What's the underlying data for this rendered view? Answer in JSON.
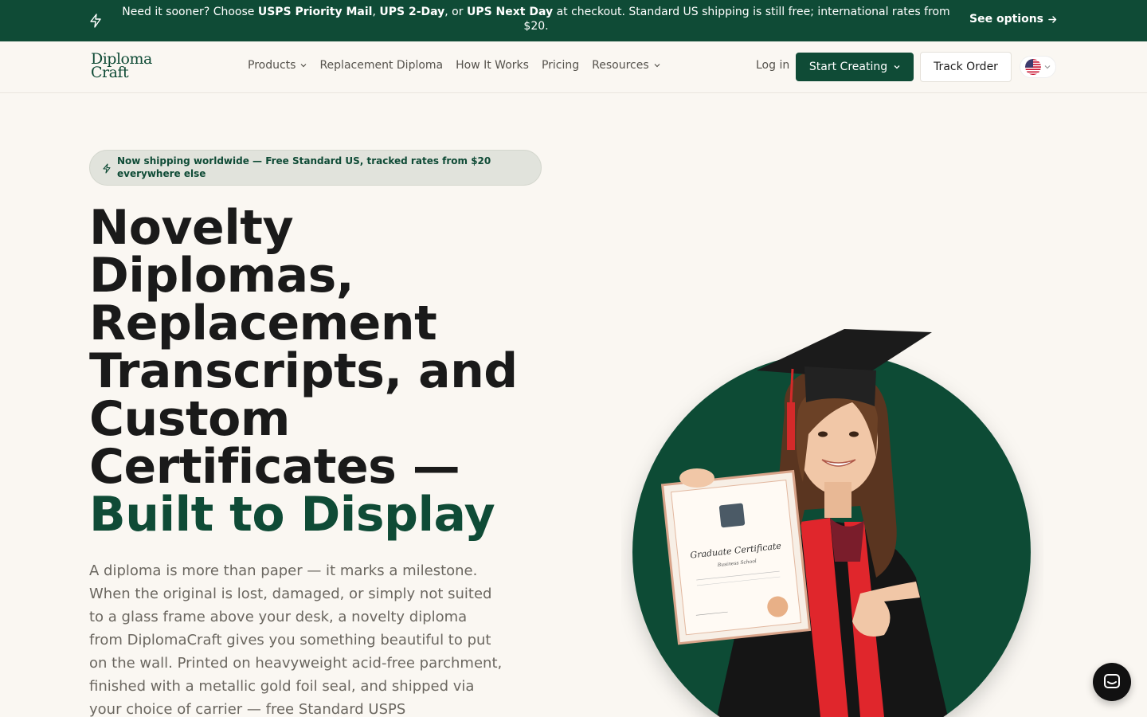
{
  "announcement": {
    "pre": "Need it sooner? Choose ",
    "opt1": "USPS Priority Mail",
    "sep1": ", ",
    "opt2": "UPS 2-Day",
    "sep2": ", or ",
    "opt3": "UPS Next Day",
    "post": " at checkout. Standard US shipping is still free; international rates from $20.",
    "cta": "See options",
    "cta_icon": "arrow-right-icon",
    "icon": "bolt-icon"
  },
  "nav": {
    "logo_line1": "Diploma",
    "logo_line2": "Craft",
    "items": [
      {
        "label": "Products",
        "dropdown": true
      },
      {
        "label": "Replacement Diploma",
        "dropdown": false
      },
      {
        "label": "How It Works",
        "dropdown": false
      },
      {
        "label": "Pricing",
        "dropdown": false
      },
      {
        "label": "Resources",
        "dropdown": true
      }
    ],
    "login": "Log in",
    "start": "Start Creating",
    "track": "Track Order",
    "language_flag": "us-flag-icon"
  },
  "hero": {
    "badge": "Now shipping worldwide — Free Standard US, tracked rates from $20 everywhere else",
    "title_line1": "Novelty",
    "title_line2": "Diplomas,",
    "title_line3": "Replacement",
    "title_line4": "Transcripts, and",
    "title_line5": "Custom",
    "title_line6": "Certificates —",
    "title_accent": "Built to Display",
    "paragraph": "A diploma is more than paper — it marks a milestone. When the original is lost, damaged, or simply not suited to a glass frame above your desk, a novelty diploma from DiplomaCraft gives you something beautiful to put on the wall. Printed on heavyweight acid-free parchment, finished with a metallic gold foil seal, and shipped via your choice of carrier — free Standard USPS",
    "image": {
      "certificate_title": "Graduate Certificate",
      "certificate_subtitle": "Business School"
    }
  },
  "colors": {
    "brand": "#0f4b36",
    "background": "#faf7f2",
    "heading": "#1a1a1a",
    "body_text": "#6b6760",
    "sash": "#e0262c"
  },
  "chat_icon": "chat-icon"
}
